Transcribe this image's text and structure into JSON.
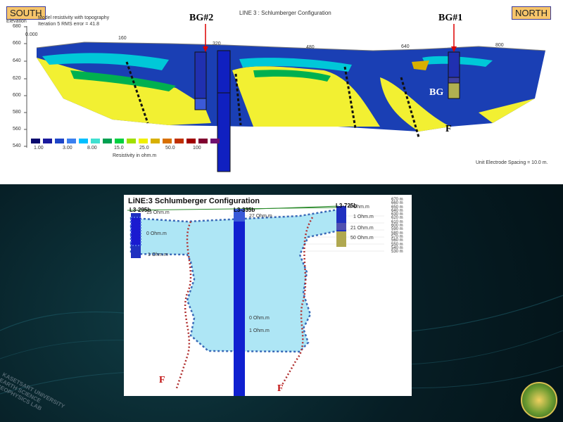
{
  "top_panel": {
    "south_label": "SOUTH",
    "north_label": "NORTH",
    "elevation_label": "Elevation",
    "model_title": "Model resistivity with topography",
    "iteration_text": "Iteration 5 RMS error = 41.8",
    "line_title": "LINE 3 : Schlumberger Configuration",
    "borehole_labels": [
      "BG#2",
      "BG#1"
    ],
    "bg_label": "BG",
    "fault_label": "F",
    "distance_ticks": [
      "0.000",
      "160",
      "320",
      "480",
      "640",
      "800"
    ],
    "elevation_ticks": [
      "680",
      "660",
      "640",
      "620",
      "600",
      "580",
      "560",
      "540"
    ],
    "legend_values": [
      "1.00",
      "3.00",
      "8.00",
      "15.0",
      "25.0",
      "50.0",
      "100"
    ],
    "legend_title": "Resistivity in ohm.m",
    "legend_colors": [
      "#0a0a6e",
      "#1a1a9c",
      "#1e46c8",
      "#3a80f0",
      "#00bfff",
      "#40e0d0",
      "#00a050",
      "#00d040",
      "#a0e000",
      "#f0f000",
      "#d8b000",
      "#d87000",
      "#c03000",
      "#a00000",
      "#800030",
      "#701070"
    ],
    "electrode_spacing": "Unit Electrode Spacing = 10.0 m."
  },
  "bottom_panel": {
    "title": "LiNE:3 Schlumberger Configuration",
    "well_labels": [
      "L3-295b",
      "L3-335b",
      "L3-725b"
    ],
    "resistivity_labels": [
      "13 Ohm.m",
      "27 Ohm.m",
      "0 Ohm.m",
      "1 Ohm.m",
      "0 Ohm.m",
      "1 Ohm.m",
      "4 Ohm.m",
      "1 Ohm.m",
      "21 Ohm.m",
      "50 Ohm.m"
    ],
    "depth_scale": [
      "670 m",
      "660 m",
      "650 m",
      "640 m",
      "630 m",
      "620 m",
      "610 m",
      "600 m",
      "590 m",
      "580 m",
      "570 m",
      "560 m",
      "550 m",
      "540 m",
      "530 m"
    ],
    "fault_labels": [
      "F",
      "F"
    ]
  },
  "watermark": {
    "university_lines": [
      "KASETSART UNIVERSITY",
      "EARTH SCIENCE",
      "GEOPHYSICS LAB"
    ]
  }
}
